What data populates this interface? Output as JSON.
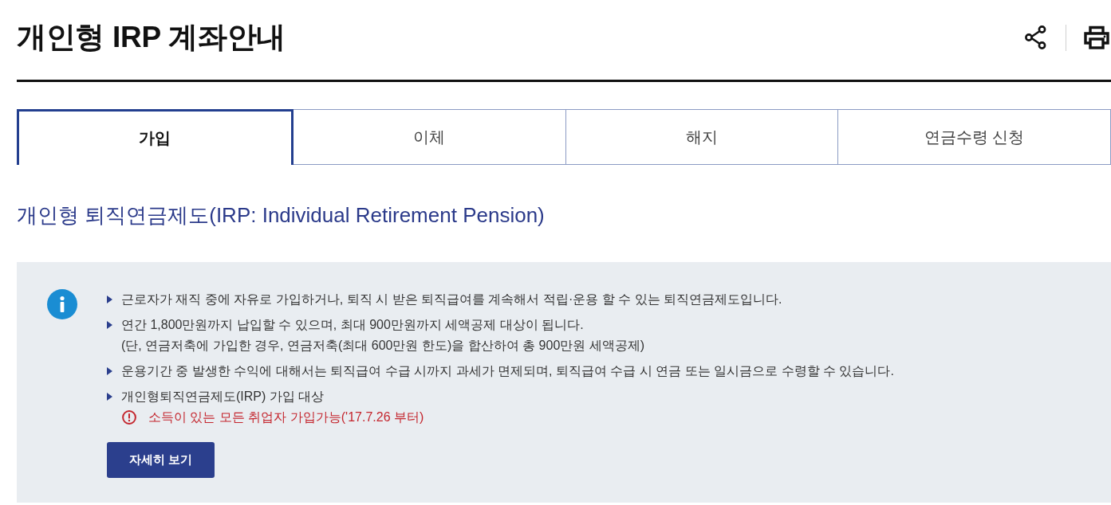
{
  "header": {
    "title": "개인형 IRP 계좌안내",
    "actions": [
      {
        "kind": "share"
      },
      {
        "kind": "print"
      }
    ]
  },
  "tabs": [
    {
      "label": "가입",
      "selected": true
    },
    {
      "label": "이체",
      "selected": false
    },
    {
      "label": "해지",
      "selected": false
    },
    {
      "label": "연금수령 신청",
      "selected": false
    }
  ],
  "section_title": "개인형 퇴직연금제도(IRP: Individual Retirement Pension)",
  "info_box": {
    "items": [
      {
        "text": "근로자가 재직 중에 자유로 가입하거나, 퇴직 시 받은 퇴직급여를 계속해서 적립·운용 할 수 있는 퇴직연금제도입니다."
      },
      {
        "text": "연간 1,800만원까지 납입할 수 있으며, 최대 900만원까지 세액공제 대상이 됩니다.",
        "note": "(단, 연금저축에 가입한 경우, 연금저축(최대 600만원 한도)을 합산하여 총 900만원 세액공제)"
      },
      {
        "text": "운용기간 중 발생한 수익에 대해서는 퇴직급여 수급 시까지 과세가 면제되며, 퇴직급여 수급 시 연금 또는 일시금으로 수령할 수 있습니다."
      },
      {
        "text": "개인형퇴직연금제도(IRP) 가입 대상",
        "alert": "소득이 있는 모든 취업자 가입가능('17.7.26 부터)"
      }
    ],
    "button": "자세히 보기"
  }
}
